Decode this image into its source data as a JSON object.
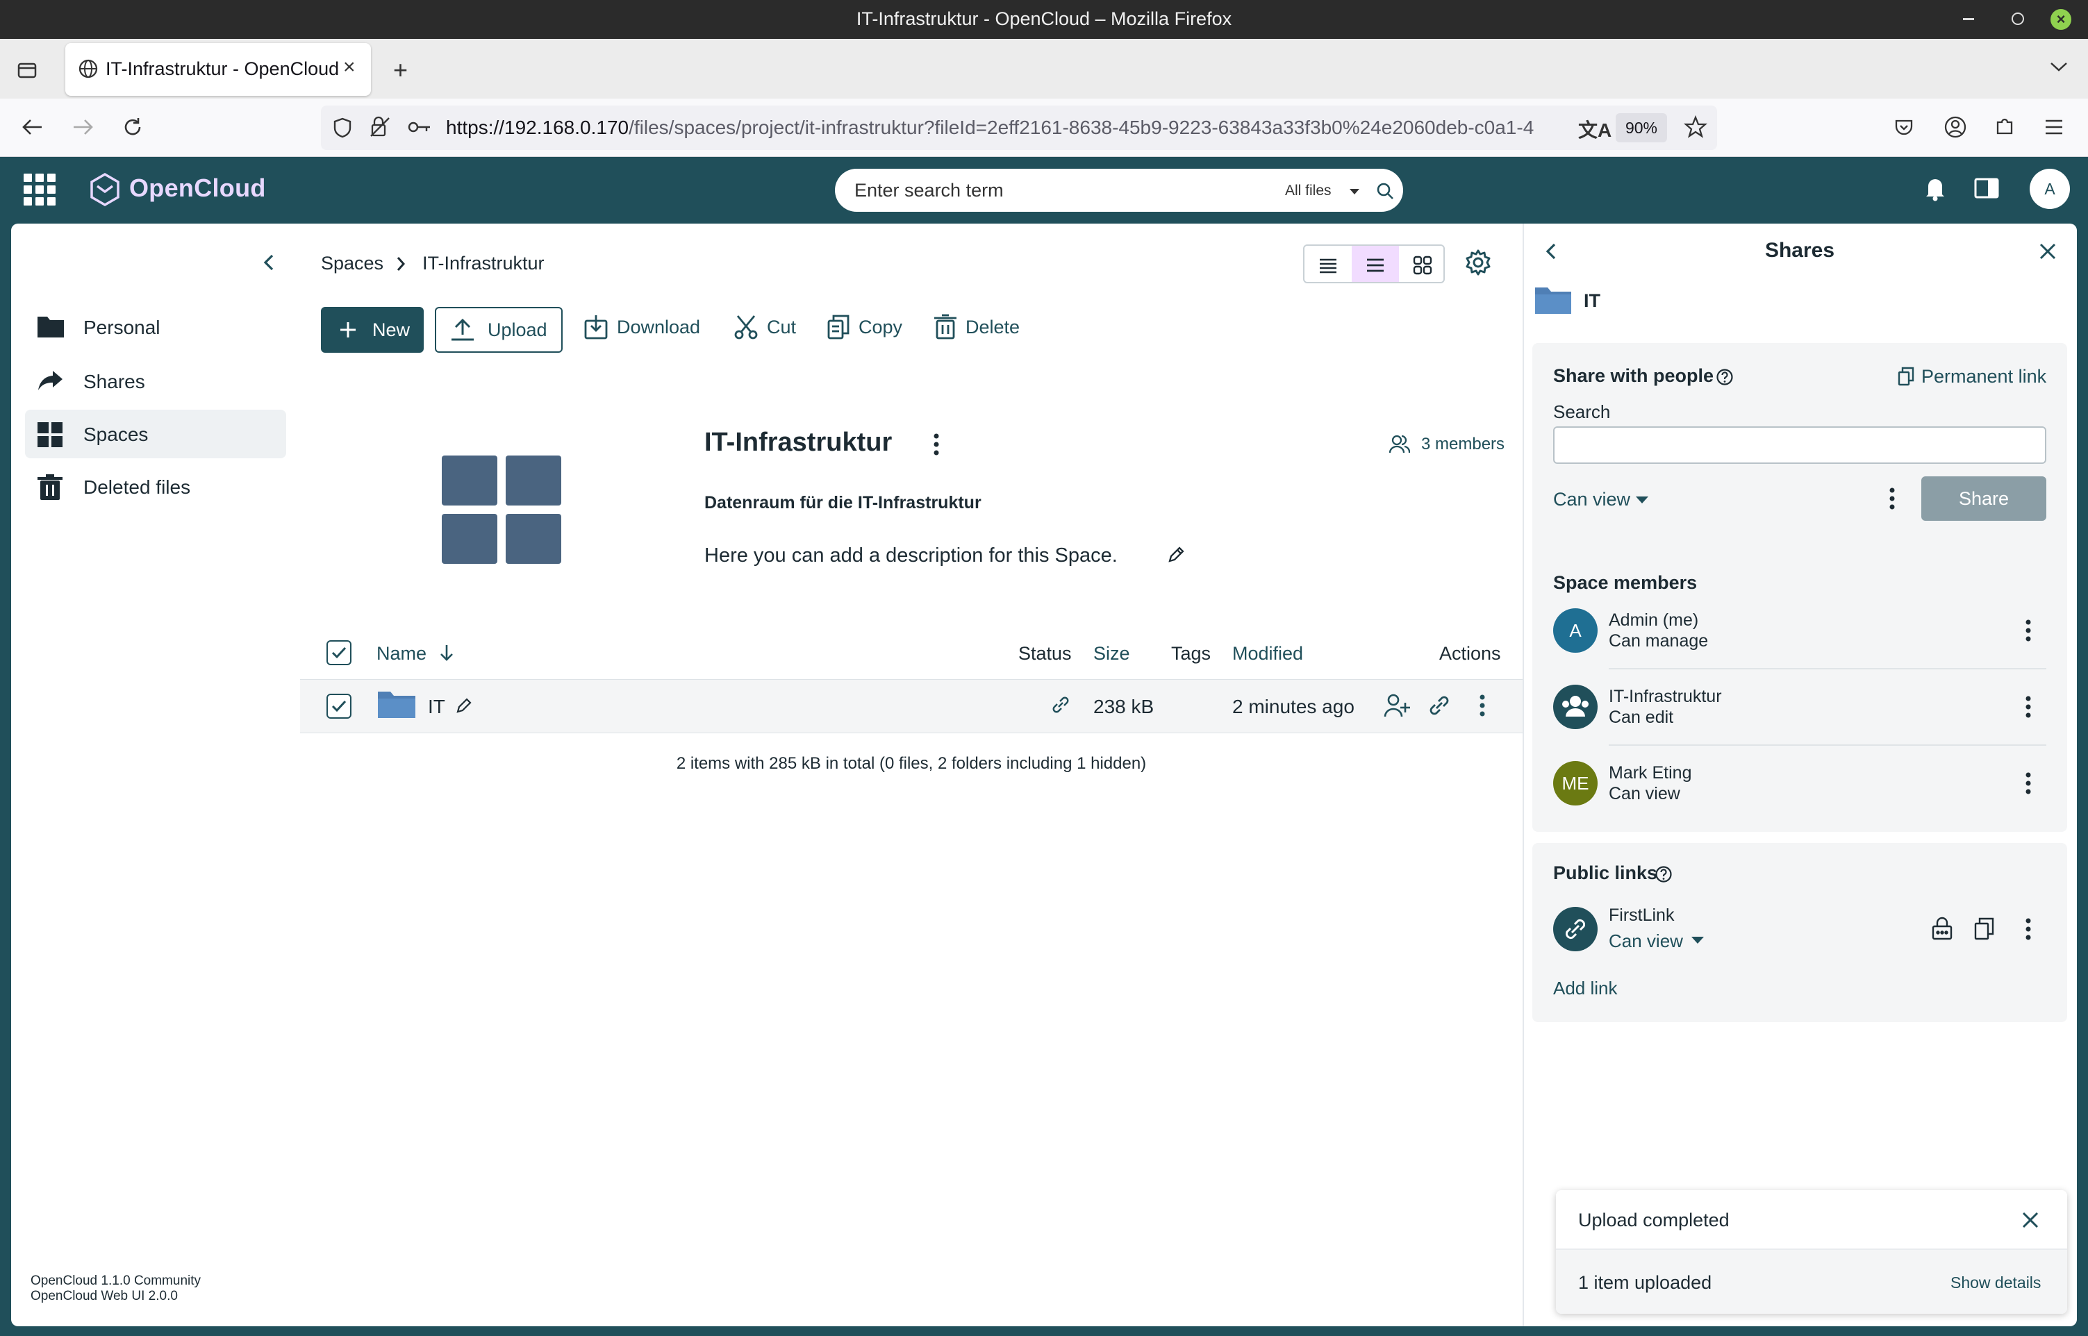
{
  "browser": {
    "window_title": "IT-Infrastruktur - OpenCloud – Mozilla Firefox",
    "tab_title": "IT-Infrastruktur - OpenCloud",
    "url_host": "https://192.168.0.170",
    "url_path": "/files/spaces/project/it-infrastruktur?fileId=2eff2161-8638-45b9-9223-63843a33f3b0%24e2060deb-c0a1-4",
    "zoom": "90%"
  },
  "app": {
    "brand": "OpenCloud",
    "search_placeholder": "Enter search term",
    "search_scope": "All files",
    "user_initial": "A",
    "accent": "#204f5a"
  },
  "sidebar": {
    "items": [
      {
        "label": "Personal",
        "icon": "folder-icon"
      },
      {
        "label": "Shares",
        "icon": "share-arrow-icon"
      },
      {
        "label": "Spaces",
        "icon": "grid-icon",
        "active": true
      },
      {
        "label": "Deleted files",
        "icon": "trash-icon"
      }
    ],
    "version_line1": "OpenCloud 1.1.0 Community",
    "version_line2": "OpenCloud Web UI 2.0.0"
  },
  "breadcrumb": {
    "root": "Spaces",
    "current": "IT-Infrastruktur"
  },
  "toolbar": {
    "new": "New",
    "upload": "Upload",
    "download": "Download",
    "cut": "Cut",
    "copy": "Copy",
    "delete": "Delete"
  },
  "space": {
    "title": "IT-Infrastruktur",
    "subtitle": "Datenraum für die IT-Infrastruktur",
    "description": "Here you can add a description for this Space.",
    "members": "3 members"
  },
  "table": {
    "headers": {
      "name": "Name",
      "status": "Status",
      "size": "Size",
      "tags": "Tags",
      "modified": "Modified",
      "actions": "Actions"
    },
    "rows": [
      {
        "name": "IT",
        "size": "238 kB",
        "modified": "2 minutes ago",
        "selected": true
      }
    ],
    "summary": "2 items with 285 kB in total (0 files, 2 folders including 1 hidden)"
  },
  "panel": {
    "title": "Shares",
    "item_name": "IT",
    "share_with_people": "Share with people",
    "permanent_link": "Permanent link",
    "search_label": "Search",
    "role": "Can view",
    "share_button": "Share",
    "space_members_title": "Space members",
    "members": [
      {
        "initials": "A",
        "name": "Admin (me)",
        "role": "Can manage",
        "color": "#1f6f93"
      },
      {
        "initials": "",
        "name": "IT-Infrastruktur",
        "role": "Can edit",
        "color": "#204f5a"
      },
      {
        "initials": "ME",
        "name": "Mark Eting",
        "role": "Can view",
        "color": "#6b7a12"
      }
    ],
    "public_links_title": "Public links",
    "link_name": "FirstLink",
    "link_role": "Can view",
    "add_link": "Add link"
  },
  "toast": {
    "title": "Upload completed",
    "body": "1 item uploaded",
    "details": "Show details"
  }
}
